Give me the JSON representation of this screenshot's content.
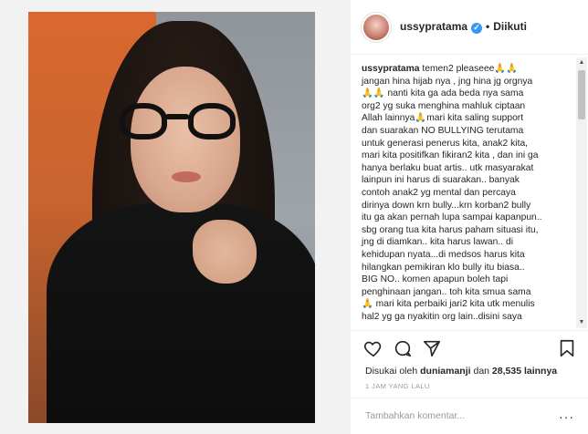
{
  "post": {
    "username": "ussypratama",
    "follow_status": "Diikuti",
    "dot": "•",
    "caption": {
      "username": "ussypratama",
      "text": " temen2 pleaseee🙏🙏\njangan hina hijab nya , jng hina jg orgnya\n🙏🙏 nanti kita ga ada beda nya sama\norg2 yg suka menghina mahluk ciptaan\nAllah lainnya🙏mari kita saling support\ndan suarakan NO BULLYING terutama\nuntuk generasi penerus kita, anak2 kita,\nmari kita positifkan fikiran2 kita , dan ini ga\nhanya berlaku buat artis.. utk masyarakat\nlainpun ini harus di suarakan.. banyak\ncontoh anak2 yg mental dan percaya\ndirinya down krn bully...krn korban2 bully\nitu ga akan pernah lupa sampai kapanpun..\nsbg orang tua kita harus paham situasi itu,\njng di diamkan.. kita harus lawan.. di\nkehidupan nyata...di medsos harus kita\nhilangkan pemikiran klo bully itu biasa..\nBIG NO.. komen apapun boleh tapi\npenghinaan jangan.. toh kita smua sama\n🙏 mari kita perbaiki jari2 kita utk menulis\nhal2 yg ga nyakitin org lain..disini saya"
    },
    "likes": {
      "prefix": "Disukai oleh ",
      "user": "duniamanji",
      "middle": " dan ",
      "count": "28,535 lainnya"
    },
    "timestamp": "1 JAM YANG LALU",
    "comment_placeholder": "Tambahkan komentar..."
  },
  "icons": {
    "like": "heart-icon",
    "comment": "comment-icon",
    "share": "share-icon",
    "save": "bookmark-icon",
    "more": "more-options-icon",
    "verified": "verified-badge-icon"
  },
  "colors": {
    "verified": "#3897f0",
    "text": "#262626",
    "muted": "#999999",
    "border": "#efefef"
  }
}
